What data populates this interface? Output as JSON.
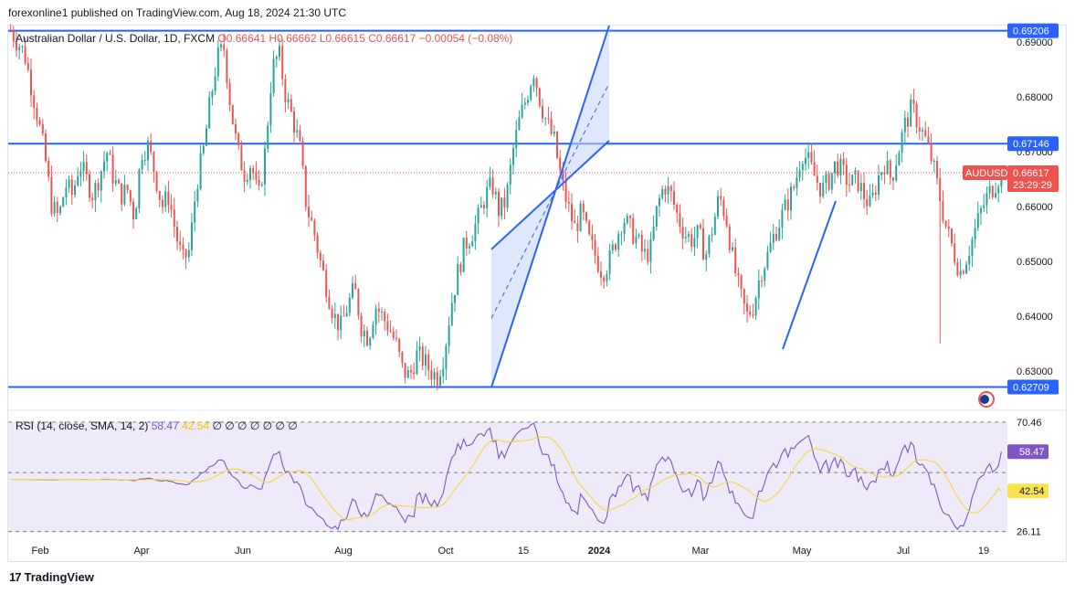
{
  "header": {
    "published_text": "forexonline1 published on TradingView.com, Aug 18, 2024 21:30 UTC"
  },
  "legend": {
    "symbol": "Australian Dollar / U.S. Dollar, 1D, FXCM",
    "ohlc": "O0.66641 H0.66662 L0.66615 C0.66617 −0.00054 (−0.08%)"
  },
  "rsi_legend": {
    "label": "RSI (14, close, SMA, 14, 2)",
    "rsi_value": "58.47",
    "sma_value": "42.54",
    "extra": "∅ ∅ ∅ ∅ ∅ ∅ ∅"
  },
  "footer": {
    "brand": "TradingView",
    "logo": "17"
  },
  "colors": {
    "up": "#26a69a",
    "down": "#ef5350",
    "line_blue": "#2962ff",
    "channel_fill": "#c5d3fb",
    "rsi_line": "#7e57c2",
    "rsi_sma": "#f5d63c",
    "rsi_band": "#efeaf9"
  },
  "chart_data": [
    {
      "type": "candlestick",
      "symbol": "AUDUSD",
      "ylim": [
        0.624,
        0.693
      ],
      "y_ticks": [
        "0.69000",
        "0.68000",
        "0.67000",
        "0.66000",
        "0.65000",
        "0.64000",
        "0.63000"
      ],
      "x_ticks": [
        "Feb",
        "Apr",
        "Jun",
        "Aug",
        "Oct",
        "15",
        "2024",
        "Mar",
        "May",
        "Jul",
        "19"
      ],
      "price_labels": [
        {
          "text": "0.69206",
          "value": 0.69206
        },
        {
          "text": "0.67146",
          "value": 0.67146
        },
        {
          "text": "0.62709",
          "value": 0.62709
        }
      ],
      "current": {
        "symbol_label": "AUDUSD",
        "price": "0.66617",
        "countdown": "23:29:29",
        "value": 0.66617
      },
      "horizontal_lines": [
        0.69206,
        0.67146,
        0.62709
      ],
      "path_closes": [
        0.692,
        0.69,
        0.688,
        0.682,
        0.676,
        0.669,
        0.66,
        0.658,
        0.664,
        0.662,
        0.668,
        0.665,
        0.662,
        0.666,
        0.67,
        0.665,
        0.662,
        0.663,
        0.658,
        0.67,
        0.671,
        0.666,
        0.66,
        0.662,
        0.655,
        0.65,
        0.652,
        0.664,
        0.67,
        0.679,
        0.687,
        0.689,
        0.678,
        0.67,
        0.666,
        0.668,
        0.661,
        0.67,
        0.685,
        0.688,
        0.68,
        0.676,
        0.671,
        0.66,
        0.656,
        0.65,
        0.645,
        0.64,
        0.638,
        0.642,
        0.645,
        0.638,
        0.636,
        0.642,
        0.64,
        0.638,
        0.635,
        0.63,
        0.629,
        0.633,
        0.632,
        0.63,
        0.629,
        0.633,
        0.642,
        0.648,
        0.653,
        0.655,
        0.658,
        0.662,
        0.664,
        0.659,
        0.661,
        0.67,
        0.676,
        0.68,
        0.685,
        0.679,
        0.675,
        0.672,
        0.665,
        0.66,
        0.656,
        0.659,
        0.654,
        0.651,
        0.648,
        0.65,
        0.654,
        0.658,
        0.656,
        0.654,
        0.651,
        0.652,
        0.66,
        0.664,
        0.662,
        0.658,
        0.655,
        0.654,
        0.655,
        0.651,
        0.656,
        0.662,
        0.658,
        0.65,
        0.644,
        0.64,
        0.642,
        0.648,
        0.651,
        0.655,
        0.658,
        0.661,
        0.664,
        0.67,
        0.668,
        0.665,
        0.663,
        0.665,
        0.668,
        0.666,
        0.664,
        0.665,
        0.662,
        0.66,
        0.665,
        0.668,
        0.665,
        0.67,
        0.675,
        0.678,
        0.675,
        0.672,
        0.668,
        0.662,
        0.656,
        0.652,
        0.648,
        0.651,
        0.655,
        0.659,
        0.662,
        0.664,
        0.66617
      ]
    },
    {
      "type": "line",
      "name": "RSI (14, close, SMA, 14, 2)",
      "ylim": [
        23,
        73
      ],
      "levels": [
        70.46,
        50,
        26.11
      ],
      "y_ticks": [
        "70.46",
        "26.11"
      ],
      "rsi_label": "58.47",
      "sma_label": "42.54",
      "rsi_last": 58.47,
      "sma_last": 42.54
    }
  ]
}
